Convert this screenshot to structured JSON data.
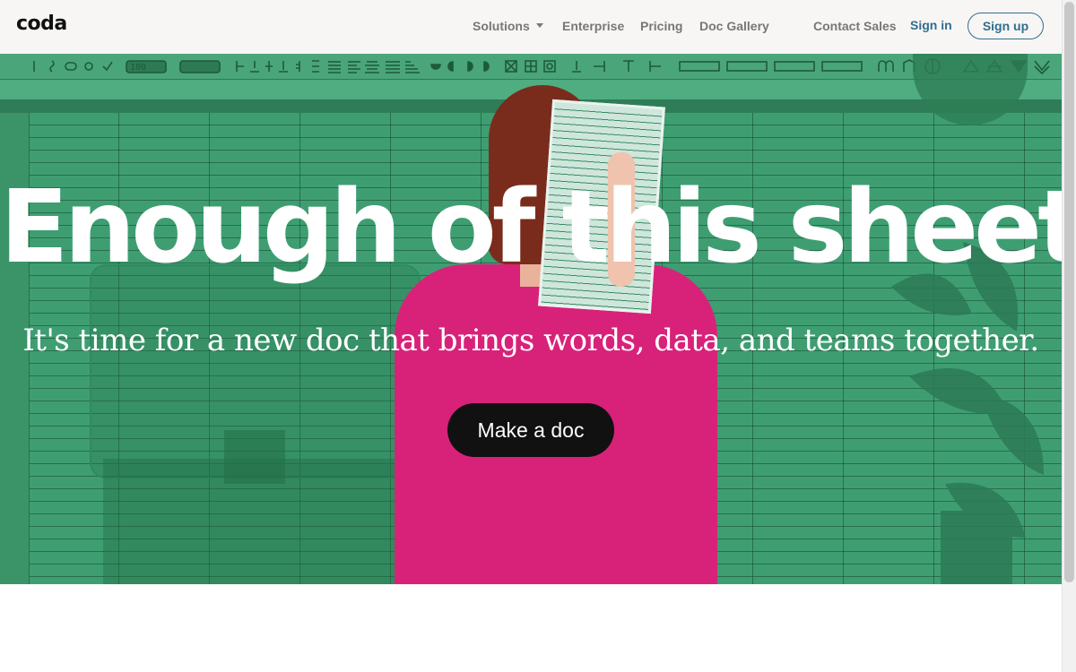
{
  "header": {
    "logo": "coda",
    "nav": {
      "solutions": "Solutions",
      "enterprise": "Enterprise",
      "pricing": "Pricing",
      "doc_gallery": "Doc Gallery",
      "contact_sales": "Contact Sales",
      "sign_in": "Sign in",
      "sign_up": "Sign up"
    }
  },
  "hero": {
    "headline": "Enough of this sheet.",
    "subheadline": "It's time for a new doc that brings words, data, and teams together.",
    "cta": "Make a doc",
    "toolbar_zoom": "100"
  },
  "colors": {
    "accent": "#2f6e8f",
    "hero_green": "#3e9e72",
    "cta_background": "#111111",
    "header_background": "#f8f6f4",
    "sweater_pink": "#d8227a"
  }
}
